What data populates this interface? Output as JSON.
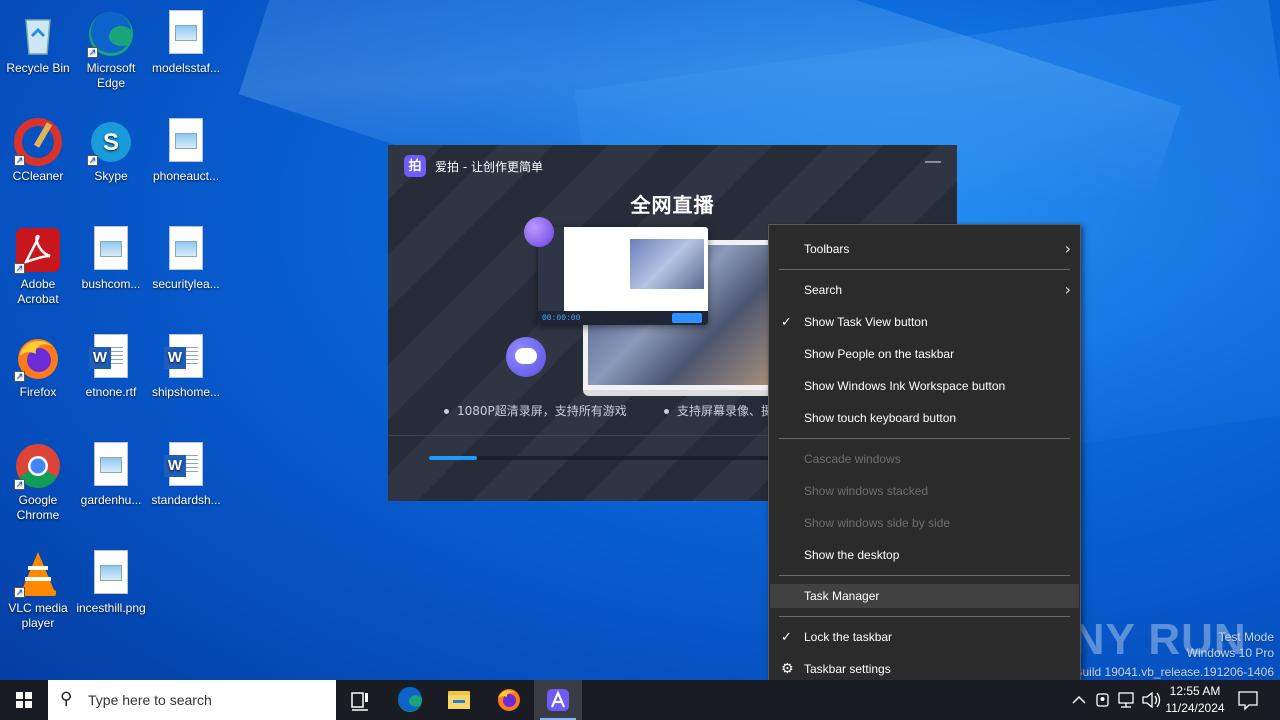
{
  "desktop": {
    "icons": [
      {
        "label": "Recycle Bin",
        "icon": "recycle-bin-icon"
      },
      {
        "label": "Microsoft Edge",
        "icon": "edge-icon"
      },
      {
        "label": "modelsstaf...",
        "icon": "image-file-icon"
      },
      {
        "label": "CCleaner",
        "icon": "ccleaner-icon"
      },
      {
        "label": "Skype",
        "icon": "skype-icon"
      },
      {
        "label": "phoneauct...",
        "icon": "image-file-icon"
      },
      {
        "label": "Adobe Acrobat",
        "icon": "acrobat-icon"
      },
      {
        "label": "bushcom...",
        "icon": "image-file-icon"
      },
      {
        "label": "securitylea...",
        "icon": "image-file-icon"
      },
      {
        "label": "Firefox",
        "icon": "firefox-icon"
      },
      {
        "label": "etnone.rtf",
        "icon": "word-file-icon"
      },
      {
        "label": "shipshome...",
        "icon": "word-file-icon"
      },
      {
        "label": "Google Chrome",
        "icon": "chrome-icon"
      },
      {
        "label": "gardenhu...",
        "icon": "image-file-icon"
      },
      {
        "label": "standardsh...",
        "icon": "word-file-icon"
      },
      {
        "label": "VLC media player",
        "icon": "vlc-icon"
      },
      {
        "label": "incesthill.png",
        "icon": "image-file-icon"
      }
    ]
  },
  "app_window": {
    "title": "爱拍 - 让创作更简单",
    "headline": "全网直播",
    "features": [
      "1080P超清录屏，支持所有游戏",
      "支持屏幕录像、摄"
    ],
    "preview_time": "00:00:00",
    "progress_percent": 12
  },
  "context_menu": {
    "items": [
      {
        "label": "Toolbars",
        "checked": false,
        "disabled": false,
        "submenu": true
      },
      {
        "label": "Search",
        "checked": false,
        "disabled": false,
        "submenu": true
      },
      {
        "label": "Show Task View button",
        "checked": true,
        "disabled": false
      },
      {
        "label": "Show People on the taskbar",
        "checked": false,
        "disabled": false
      },
      {
        "label": "Show Windows Ink Workspace button",
        "checked": false,
        "disabled": false
      },
      {
        "label": "Show touch keyboard button",
        "checked": false,
        "disabled": false
      },
      {
        "label": "Cascade windows",
        "checked": false,
        "disabled": true
      },
      {
        "label": "Show windows stacked",
        "checked": false,
        "disabled": true
      },
      {
        "label": "Show windows side by side",
        "checked": false,
        "disabled": true
      },
      {
        "label": "Show the desktop",
        "checked": false,
        "disabled": false
      },
      {
        "label": "Task Manager",
        "checked": false,
        "disabled": false,
        "hover": true
      },
      {
        "label": "Lock the taskbar",
        "checked": true,
        "disabled": false
      },
      {
        "label": "Taskbar settings",
        "checked": false,
        "disabled": false,
        "icon": "gear-icon"
      }
    ],
    "check_glyph": "✓",
    "arrow_glyph": "›",
    "gear_glyph": "⚙"
  },
  "watermark": {
    "brand": "ANY RUN",
    "mode": "Test Mode",
    "edition": "Windows 10 Pro",
    "build": "Build 19041.vb_release.191206-1406"
  },
  "taskbar": {
    "search_placeholder": "Type here to search",
    "pinned": [
      "task-view-icon",
      "edge-icon",
      "file-explorer-icon",
      "firefox-icon",
      "aipai-icon"
    ],
    "active_app": "aipai-icon",
    "time": "12:55 AM",
    "date": "11/24/2024",
    "tray_icons": [
      "chevron-up-icon",
      "meet-now-icon",
      "network-icon",
      "volume-icon",
      "notification-icon"
    ]
  },
  "colors": {
    "accent": "#1e9bff",
    "menu_bg": "#2b2b2b",
    "taskbar_bg": "#191c22"
  }
}
